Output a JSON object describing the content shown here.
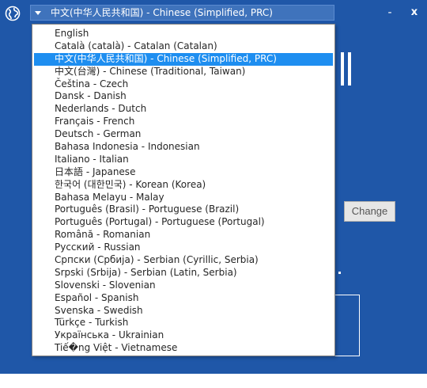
{
  "header": {
    "selected_language": "中文(中华人民共和国) - Chinese (Simplified, PRC)",
    "minimize_label": "-",
    "close_label": "x"
  },
  "dropdown": {
    "selected_index": 2,
    "options": [
      "English",
      "Català (català) - Catalan (Catalan)",
      "中文(中华人民共和国) - Chinese (Simplified, PRC)",
      "中文(台灣) - Chinese (Traditional, Taiwan)",
      "Čeština - Czech",
      "Dansk - Danish",
      "Nederlands - Dutch",
      "Français - French",
      "Deutsch - German",
      "Bahasa Indonesia - Indonesian",
      "Italiano - Italian",
      "日本語 - Japanese",
      "한국어 (대한민국) - Korean (Korea)",
      "Bahasa Melayu - Malay",
      "Português (Brasil) - Portuguese (Brazil)",
      "Português (Portugal) - Portuguese (Portugal)",
      "Română - Romanian",
      "Русский - Russian",
      "Српски (Србија) - Serbian (Cyrillic, Serbia)",
      "Srpski (Srbija) - Serbian (Latin, Serbia)",
      "Slovenski - Slovenian",
      "Español - Spanish",
      "Svenska - Swedish",
      "Türkçe - Turkish",
      "Українська - Ukrainian",
      "Tiế�ng Việt - Vietnamese"
    ]
  },
  "background": {
    "change_button_label": "Change"
  },
  "colors": {
    "window_bg": "#1f57a8",
    "select_bg": "#3f73bc",
    "highlight": "#1e8ef0"
  }
}
